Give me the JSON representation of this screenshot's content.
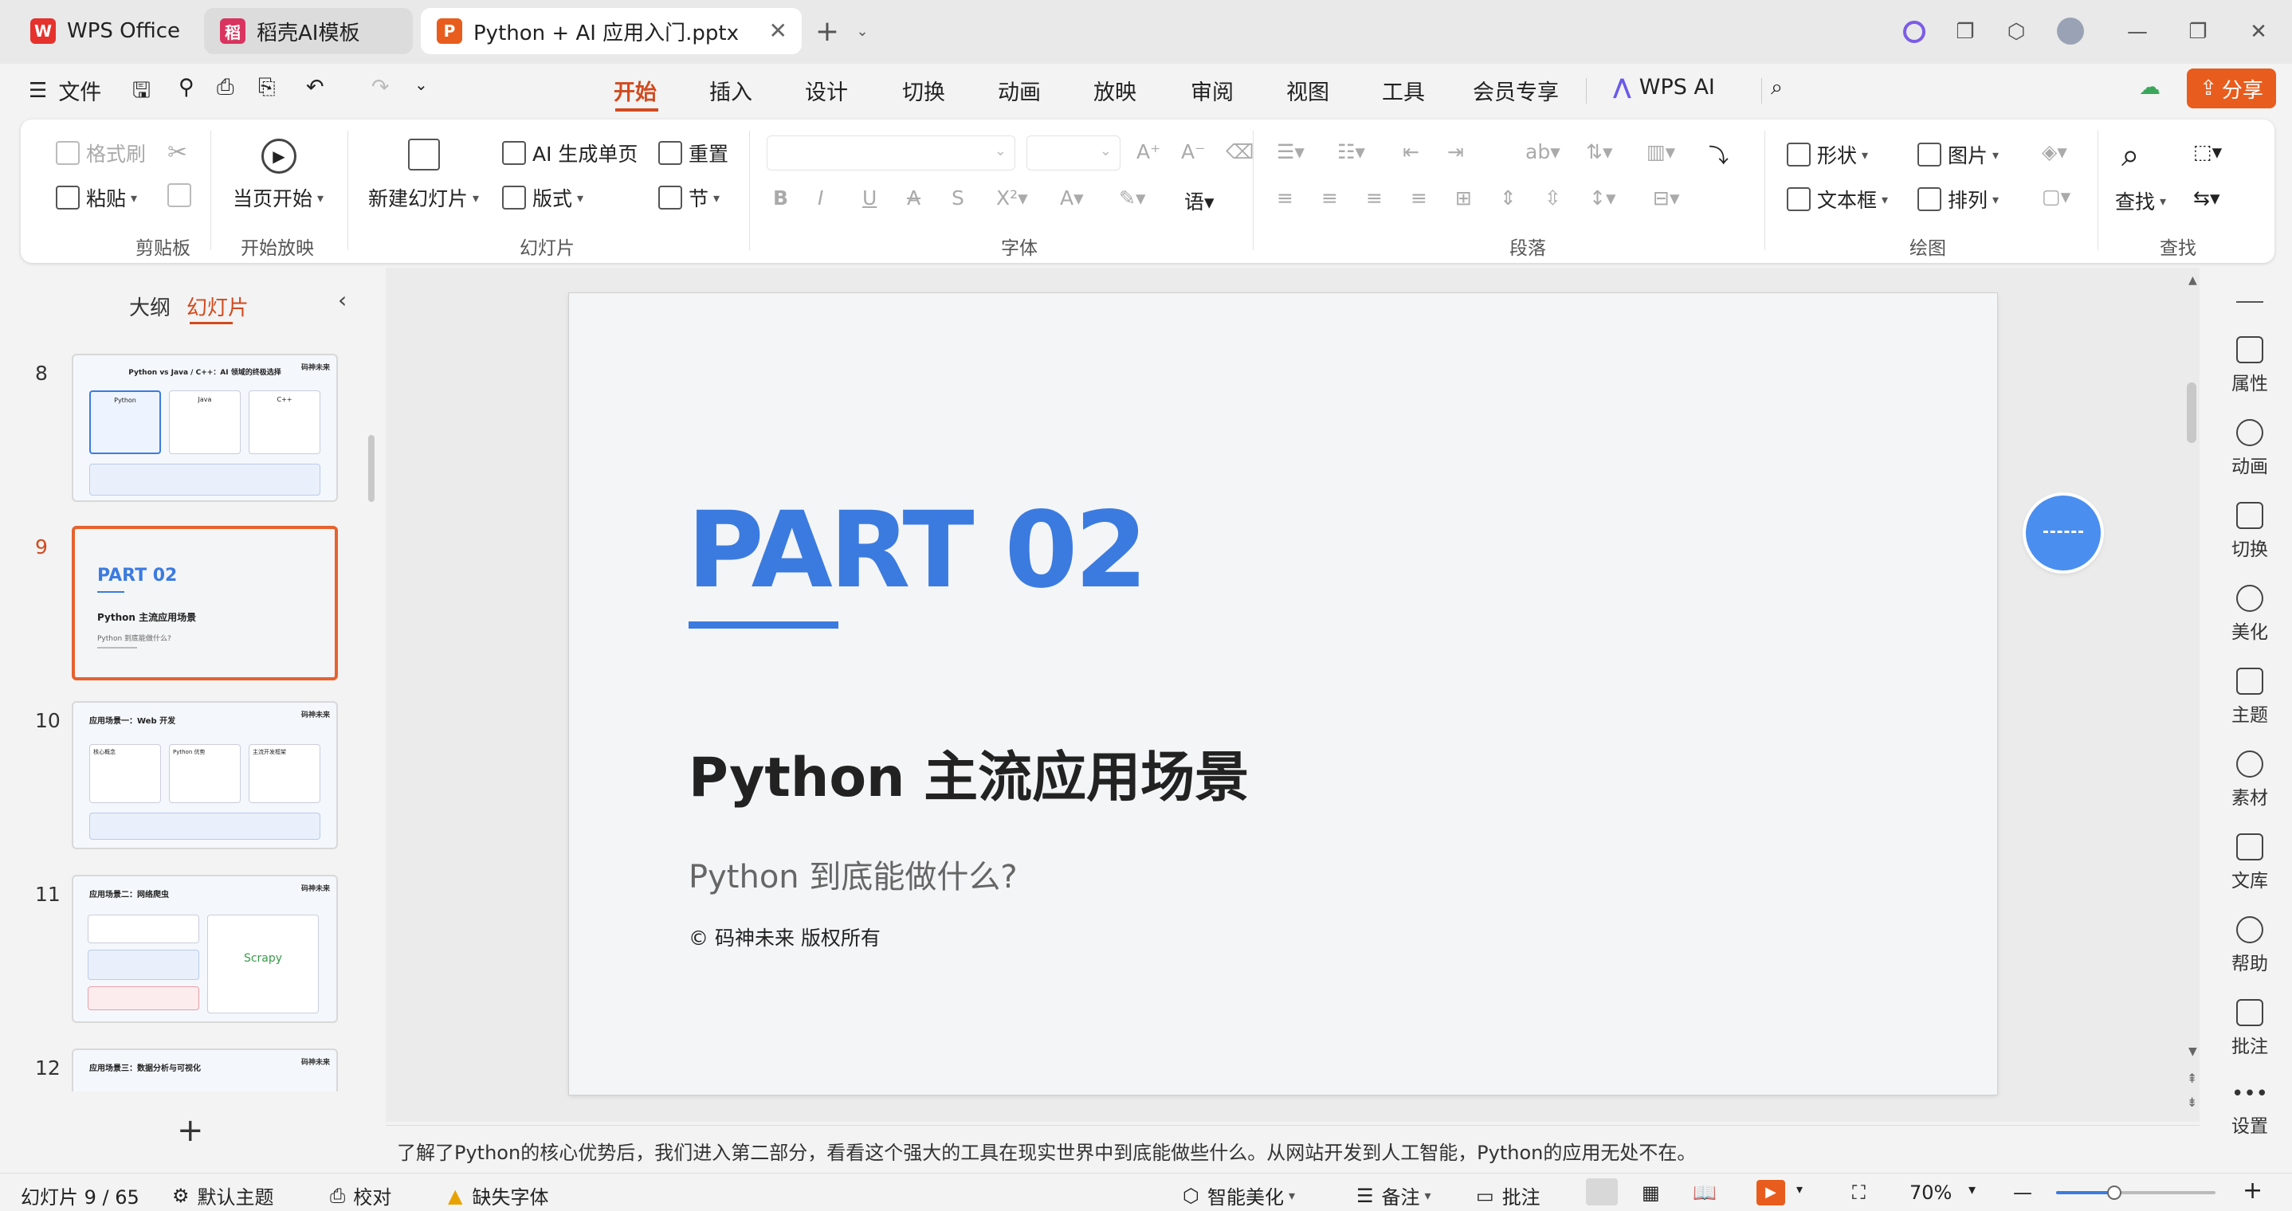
{
  "tabs": [
    {
      "label": "WPS Office",
      "color": "#e5322d"
    },
    {
      "label": "稻壳AI模板",
      "color": "#d8345f"
    },
    {
      "label": "Python + AI 应用入门.pptx",
      "color": "#e85d1d"
    }
  ],
  "menu": {
    "file": "文件",
    "items": [
      "开始",
      "插入",
      "设计",
      "切换",
      "动画",
      "放映",
      "审阅",
      "视图",
      "工具",
      "会员专享"
    ],
    "wps_ai": "WPS AI",
    "share": "分享"
  },
  "ribbon": {
    "clipboard": {
      "format_painter": "格式刷",
      "paste": "粘贴",
      "group": "剪贴板"
    },
    "slideshow": {
      "from_current": "当页开始",
      "group": "开始放映"
    },
    "slides": {
      "new_slide": "新建幻灯片",
      "ai_page": "AI 生成单页",
      "layout": "版式",
      "reset": "重置",
      "section": "节",
      "group": "幻灯片"
    },
    "font": {
      "group": "字体"
    },
    "paragraph": {
      "group": "段落"
    },
    "drawing": {
      "shape": "形状",
      "picture": "图片",
      "textbox": "文本框",
      "arrange": "排列",
      "group": "绘图"
    },
    "find": {
      "find": "查找",
      "group": "查找"
    }
  },
  "left_pane": {
    "tab_outline": "大纲",
    "tab_slides": "幻灯片",
    "thumbnails": [
      {
        "num": "8",
        "title": "Python vs Java / C++：AI 领域的终极选择",
        "cols": [
          "Python",
          "Java",
          "C++"
        ]
      },
      {
        "num": "9",
        "part": "PART 02",
        "title": "Python 主流应用场景",
        "sub": "Python 到底能做什么?"
      },
      {
        "num": "10",
        "title": "应用场景一：Web 开发",
        "cards": [
          "核心概念",
          "Python 优势",
          "主流开发框架"
        ]
      },
      {
        "num": "11",
        "title": "应用场景二：网络爬虫",
        "logo": "Scrapy"
      },
      {
        "num": "12",
        "title": "应用场景三：数据分析与可视化"
      }
    ],
    "brand": "码神未来"
  },
  "slide": {
    "part": "PART 02",
    "title": "Python 主流应用场景",
    "subtitle": "Python 到底能做什么?",
    "copyright": "© 码神未来 版权所有",
    "accent": "#3b7be0"
  },
  "right_bar": [
    "属性",
    "动画",
    "切换",
    "美化",
    "主题",
    "素材",
    "文库",
    "帮助",
    "批注",
    "设置"
  ],
  "notes": "了解了Python的核心优势后，我们进入第二部分，看看这个强大的工具在现实世界中到底能做些什么。从网站开发到人工智能，Python的应用无处不在。",
  "status": {
    "slide_count": "幻灯片 9 / 65",
    "theme": "默认主题",
    "proof": "校对",
    "missing_font": "缺失字体",
    "beautify": "智能美化",
    "notes": "备注",
    "comment": "批注",
    "zoom": "70%"
  }
}
